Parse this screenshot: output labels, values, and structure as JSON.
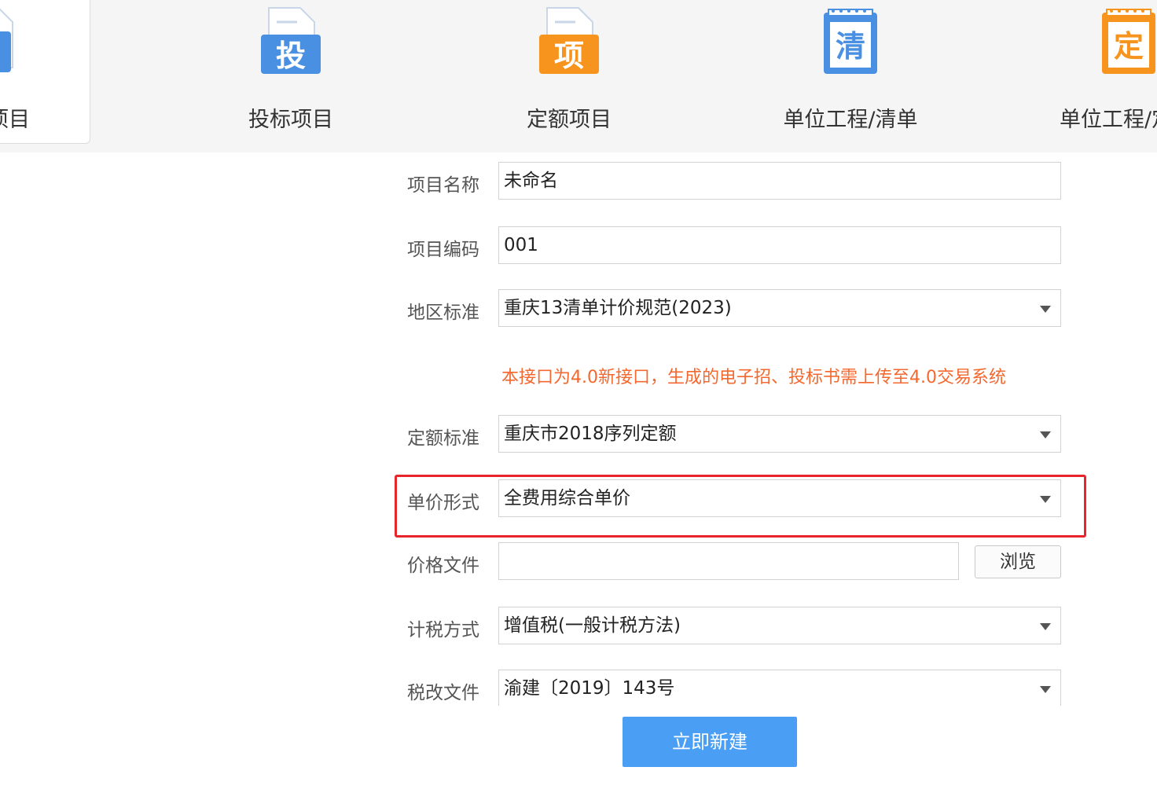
{
  "tabs": [
    {
      "label": "招标项目",
      "icon_char": "招",
      "icon": "bid-invitation-icon",
      "color": "#4a90e2"
    },
    {
      "label": "投标项目",
      "icon_char": "投",
      "icon": "bid-submission-icon",
      "color": "#4a90e2"
    },
    {
      "label": "定额项目",
      "icon_char": "项",
      "icon": "quota-project-icon",
      "color": "#f7941d"
    },
    {
      "label": "单位工程/清单",
      "icon_char": "清",
      "icon": "bill-list-icon",
      "color": "#4a90e2"
    },
    {
      "label": "单位工程/定额",
      "icon_char": "定",
      "icon": "unit-quota-icon",
      "color": "#f7941d"
    }
  ],
  "form": {
    "project_name": {
      "label": "项目名称",
      "value": "未命名"
    },
    "project_code": {
      "label": "项目编码",
      "value": "001"
    },
    "region_standard": {
      "label": "地区标准",
      "value": "重庆13清单计价规范(2023)"
    },
    "notice": "本接口为4.0新接口，生成的电子招、投标书需上传至4.0交易系统",
    "quota_standard": {
      "label": "定额标准",
      "value": "重庆市2018序列定额"
    },
    "unit_price_form": {
      "label": "单价形式",
      "value": "全费用综合单价"
    },
    "price_file": {
      "label": "价格文件",
      "value": "",
      "browse_label": "浏览"
    },
    "tax_method": {
      "label": "计税方式",
      "value": "增值税(一般计税方法)"
    },
    "tax_reform_file": {
      "label": "税改文件",
      "value": "渝建〔2019〕143号"
    }
  },
  "create_button": "立即新建",
  "colors": {
    "accent_blue": "#4a9ff5",
    "notice_orange": "#f4682f",
    "highlight_red": "#e8252a"
  }
}
